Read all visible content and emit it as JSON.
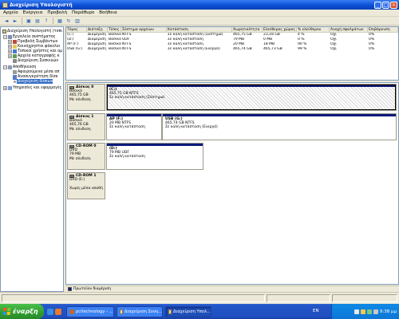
{
  "window": {
    "title": "Διαχείριση Υπολογιστή"
  },
  "menu": [
    "Αρχείο",
    "Ενέργεια",
    "Προβολή",
    "Παράθυρο",
    "Βοήθεια"
  ],
  "tree": {
    "items": [
      {
        "label": "Διαχείριση Υπολογιστή (τοπι"
      },
      {
        "label": "Εργαλεία συστήματος"
      },
      {
        "label": "Προβολή Συμβάντων"
      },
      {
        "label": "Κοινόχρηστοι φάκελοι"
      },
      {
        "label": "Τοπικοί χρήστες και ομ"
      },
      {
        "label": "Αρχεία καταγραφής κ"
      },
      {
        "label": "Διαχείριση Συσκευών"
      },
      {
        "label": "Αποθήκευση"
      },
      {
        "label": "Αφαιρούμενα μέσα απ"
      },
      {
        "label": "Ανασυγκρότηση δίσκ"
      },
      {
        "label": "Διαχείριση δίσκων"
      },
      {
        "label": "Υπηρεσίες και εφαρμογές"
      }
    ]
  },
  "volumes": {
    "columns": [
      "Τόμος",
      "Διάταξη",
      "Τύπος",
      "Σύστημα αρχείων",
      "Κατάσταση",
      "Χωρητικότητα",
      "Ελεύθερος χώρος",
      "% ελεύθερου",
      "Ανοχή σφαλμάτων",
      "Επιβάρυνση"
    ],
    "rows": [
      [
        "(C:)",
        "Διαμέριση",
        "Βασικό",
        "NTFS",
        "Σε καλή κατάσταση (Σύστημα)",
        "465,75 GB",
        "23,18 GB",
        "4 %",
        "Όχι",
        "0%"
      ],
      [
        "(D:)",
        "Διαμέριση",
        "Βασικό",
        "UDF",
        "Σε καλή κατάσταση",
        "79 MB",
        "0 MB",
        "0 %",
        "Όχι",
        "0%"
      ],
      [
        "AP (F:)",
        "Διαμέριση",
        "Βασικό",
        "NTFS",
        "Σε καλή κατάσταση",
        "20 MB",
        "18 MB",
        "90 %",
        "Όχι",
        "0%"
      ],
      [
        "USB (G:)",
        "Διαμέριση",
        "Βασικό",
        "NTFS",
        "Σε καλή κατάσταση (Ενεργό)",
        "465,74 GB",
        "465,73 GB",
        "99 %",
        "Όχι",
        "0%"
      ]
    ]
  },
  "disks": [
    {
      "name": "Δίσκος 0",
      "lines": [
        "Βασικό",
        "465,75 GB",
        "Με σύνδεση"
      ],
      "partitions": [
        {
          "label": "(C:)",
          "lines": [
            "465,75 GB NTFS",
            "Σε καλή κατάσταση (Σύστημα)"
          ]
        }
      ]
    },
    {
      "name": "Δίσκος 1",
      "lines": [
        "Βασικό",
        "465,76 GB",
        "Με σύνδεση"
      ],
      "partitions": [
        {
          "label": "AP  (F:)",
          "lines": [
            "20 MB NTFS",
            "Σε καλή κατάσταση"
          ]
        },
        {
          "label": "USB  (G:)",
          "lines": [
            "465,74 GB NTFS",
            "Σε καλή κατάσταση (Ενεργό)"
          ]
        }
      ]
    },
    {
      "name": "CD-ROM 0",
      "lines": [
        "DVD",
        "79 MB",
        "Με σύνδεση"
      ],
      "partitions": [
        {
          "label": "(D:)",
          "lines": [
            "79 MB UDF",
            "Σε καλή κατάσταση"
          ]
        }
      ]
    },
    {
      "name": "CD-ROM 1",
      "lines": [
        "DVD (E:)",
        "",
        "Χωρίς μέσα αποθή"
      ],
      "partitions": []
    }
  ],
  "legend": {
    "label": "Πρωτεύον διαμέριση",
    "color": "#0a1a7a"
  },
  "taskbar": {
    "start_label": "έναρξη",
    "tasks": [
      "pcitechnology - ...",
      "Διαχείριση Συνη...",
      "Διαχείριση Υπολ..."
    ],
    "language": "EN",
    "clock": "9:38 μμ"
  }
}
